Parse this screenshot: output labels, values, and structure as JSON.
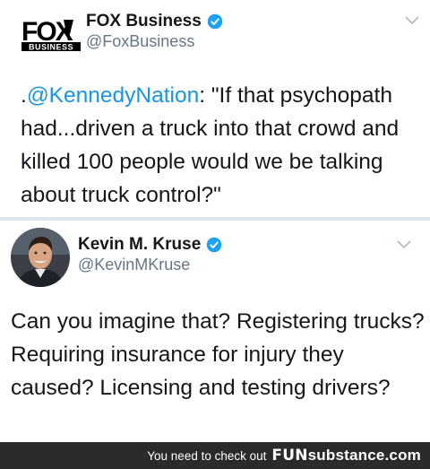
{
  "tweets": [
    {
      "author_name": "FOX Business",
      "author_handle": "@FoxBusiness",
      "logo_top": "FOX",
      "logo_bottom": "BUSINESS",
      "text_prefix": ".",
      "text_mention": "@KennedyNation",
      "text_body": ": \"If that psychopath had...driven a truck into that crowd and killed 100 people would we be talking about truck control?\""
    },
    {
      "author_name": "Kevin M. Kruse",
      "author_handle": "@KevinMKruse",
      "text_body": "Can you imagine that? Registering trucks? Requiring insurance for injury they caused? Licensing and testing drivers?"
    }
  ],
  "footer": {
    "text": "You need to check out",
    "brand_fun": "FUN",
    "brand_rest": "substance.com"
  },
  "colors": {
    "verified_blue": "#1da1f2",
    "mention_blue": "#1b95e0",
    "footer_bg": "#2b2b2b"
  },
  "icons": [
    "verified-badge-icon",
    "chevron-down-icon"
  ]
}
